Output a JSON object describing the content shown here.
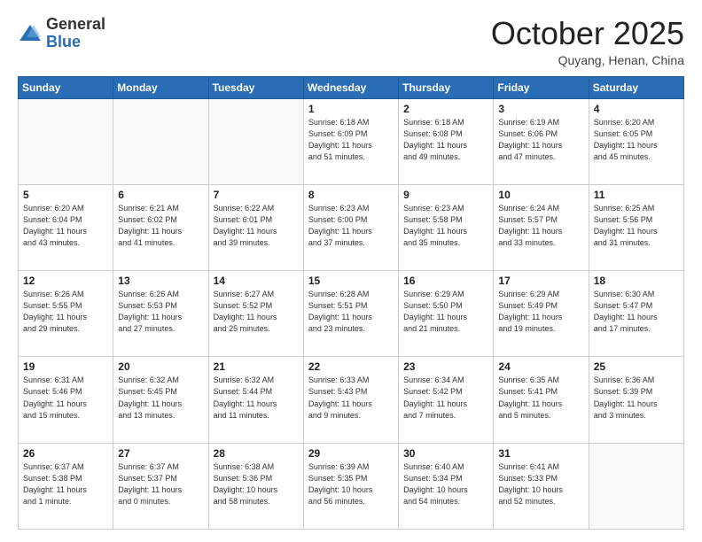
{
  "logo": {
    "general": "General",
    "blue": "Blue"
  },
  "header": {
    "month": "October 2025",
    "location": "Quyang, Henan, China"
  },
  "days_of_week": [
    "Sunday",
    "Monday",
    "Tuesday",
    "Wednesday",
    "Thursday",
    "Friday",
    "Saturday"
  ],
  "weeks": [
    [
      {
        "day": "",
        "info": ""
      },
      {
        "day": "",
        "info": ""
      },
      {
        "day": "",
        "info": ""
      },
      {
        "day": "1",
        "info": "Sunrise: 6:18 AM\nSunset: 6:09 PM\nDaylight: 11 hours\nand 51 minutes."
      },
      {
        "day": "2",
        "info": "Sunrise: 6:18 AM\nSunset: 6:08 PM\nDaylight: 11 hours\nand 49 minutes."
      },
      {
        "day": "3",
        "info": "Sunrise: 6:19 AM\nSunset: 6:06 PM\nDaylight: 11 hours\nand 47 minutes."
      },
      {
        "day": "4",
        "info": "Sunrise: 6:20 AM\nSunset: 6:05 PM\nDaylight: 11 hours\nand 45 minutes."
      }
    ],
    [
      {
        "day": "5",
        "info": "Sunrise: 6:20 AM\nSunset: 6:04 PM\nDaylight: 11 hours\nand 43 minutes."
      },
      {
        "day": "6",
        "info": "Sunrise: 6:21 AM\nSunset: 6:02 PM\nDaylight: 11 hours\nand 41 minutes."
      },
      {
        "day": "7",
        "info": "Sunrise: 6:22 AM\nSunset: 6:01 PM\nDaylight: 11 hours\nand 39 minutes."
      },
      {
        "day": "8",
        "info": "Sunrise: 6:23 AM\nSunset: 6:00 PM\nDaylight: 11 hours\nand 37 minutes."
      },
      {
        "day": "9",
        "info": "Sunrise: 6:23 AM\nSunset: 5:58 PM\nDaylight: 11 hours\nand 35 minutes."
      },
      {
        "day": "10",
        "info": "Sunrise: 6:24 AM\nSunset: 5:57 PM\nDaylight: 11 hours\nand 33 minutes."
      },
      {
        "day": "11",
        "info": "Sunrise: 6:25 AM\nSunset: 5:56 PM\nDaylight: 11 hours\nand 31 minutes."
      }
    ],
    [
      {
        "day": "12",
        "info": "Sunrise: 6:26 AM\nSunset: 5:55 PM\nDaylight: 11 hours\nand 29 minutes."
      },
      {
        "day": "13",
        "info": "Sunrise: 6:26 AM\nSunset: 5:53 PM\nDaylight: 11 hours\nand 27 minutes."
      },
      {
        "day": "14",
        "info": "Sunrise: 6:27 AM\nSunset: 5:52 PM\nDaylight: 11 hours\nand 25 minutes."
      },
      {
        "day": "15",
        "info": "Sunrise: 6:28 AM\nSunset: 5:51 PM\nDaylight: 11 hours\nand 23 minutes."
      },
      {
        "day": "16",
        "info": "Sunrise: 6:29 AM\nSunset: 5:50 PM\nDaylight: 11 hours\nand 21 minutes."
      },
      {
        "day": "17",
        "info": "Sunrise: 6:29 AM\nSunset: 5:49 PM\nDaylight: 11 hours\nand 19 minutes."
      },
      {
        "day": "18",
        "info": "Sunrise: 6:30 AM\nSunset: 5:47 PM\nDaylight: 11 hours\nand 17 minutes."
      }
    ],
    [
      {
        "day": "19",
        "info": "Sunrise: 6:31 AM\nSunset: 5:46 PM\nDaylight: 11 hours\nand 15 minutes."
      },
      {
        "day": "20",
        "info": "Sunrise: 6:32 AM\nSunset: 5:45 PM\nDaylight: 11 hours\nand 13 minutes."
      },
      {
        "day": "21",
        "info": "Sunrise: 6:32 AM\nSunset: 5:44 PM\nDaylight: 11 hours\nand 11 minutes."
      },
      {
        "day": "22",
        "info": "Sunrise: 6:33 AM\nSunset: 5:43 PM\nDaylight: 11 hours\nand 9 minutes."
      },
      {
        "day": "23",
        "info": "Sunrise: 6:34 AM\nSunset: 5:42 PM\nDaylight: 11 hours\nand 7 minutes."
      },
      {
        "day": "24",
        "info": "Sunrise: 6:35 AM\nSunset: 5:41 PM\nDaylight: 11 hours\nand 5 minutes."
      },
      {
        "day": "25",
        "info": "Sunrise: 6:36 AM\nSunset: 5:39 PM\nDaylight: 11 hours\nand 3 minutes."
      }
    ],
    [
      {
        "day": "26",
        "info": "Sunrise: 6:37 AM\nSunset: 5:38 PM\nDaylight: 11 hours\nand 1 minute."
      },
      {
        "day": "27",
        "info": "Sunrise: 6:37 AM\nSunset: 5:37 PM\nDaylight: 11 hours\nand 0 minutes."
      },
      {
        "day": "28",
        "info": "Sunrise: 6:38 AM\nSunset: 5:36 PM\nDaylight: 10 hours\nand 58 minutes."
      },
      {
        "day": "29",
        "info": "Sunrise: 6:39 AM\nSunset: 5:35 PM\nDaylight: 10 hours\nand 56 minutes."
      },
      {
        "day": "30",
        "info": "Sunrise: 6:40 AM\nSunset: 5:34 PM\nDaylight: 10 hours\nand 54 minutes."
      },
      {
        "day": "31",
        "info": "Sunrise: 6:41 AM\nSunset: 5:33 PM\nDaylight: 10 hours\nand 52 minutes."
      },
      {
        "day": "",
        "info": ""
      }
    ]
  ]
}
